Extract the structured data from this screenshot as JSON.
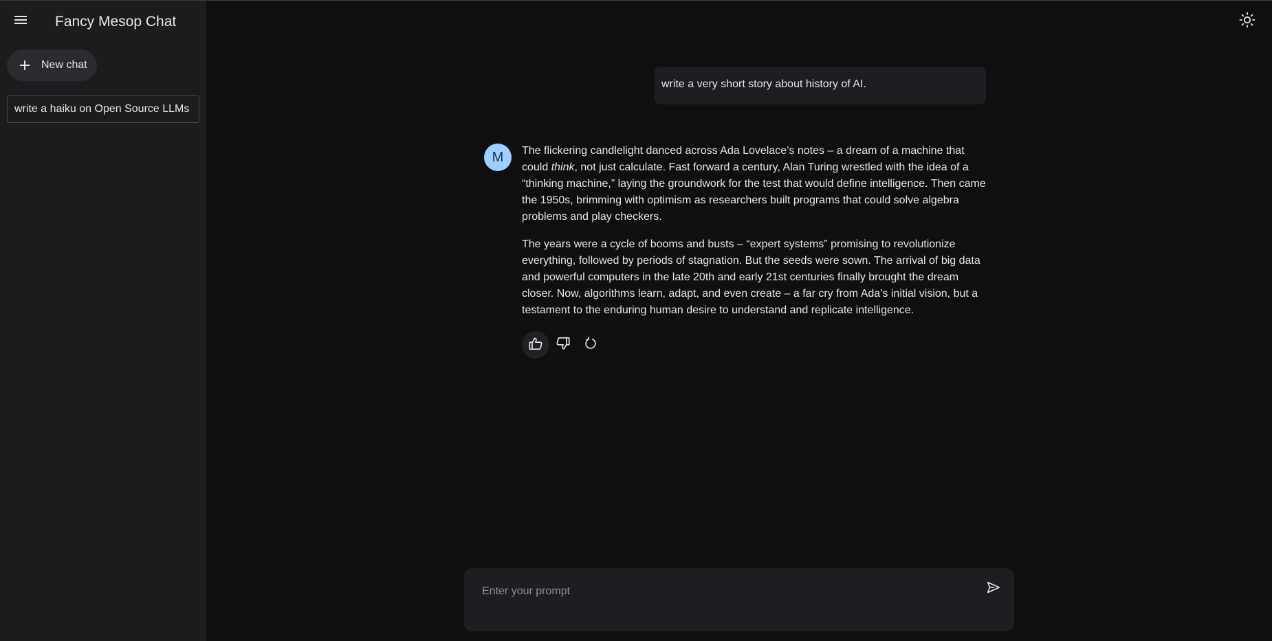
{
  "colors": {
    "sidebar_bg": "#1d1d20",
    "main_bg": "#0f0f11",
    "bubble_bg": "#1e1e22",
    "avatar_bg": "#9ecfff",
    "text": "#e6e6e9"
  },
  "sidebar": {
    "menu_icon": "hamburger-menu-icon",
    "title": "Fancy Mesop Chat",
    "new_chat": {
      "icon": "plus-icon",
      "label": "New chat"
    },
    "history": [
      {
        "label": "write a haiku on Open Source LLMs"
      }
    ]
  },
  "header": {
    "theme_icon": "sun-icon"
  },
  "conversation": {
    "user_message": "write a very short story about history of AI.",
    "assistant": {
      "avatar_letter": "M",
      "paragraph_1_before": "The flickering candlelight danced across Ada Lovelace’s notes – a dream of a machine that could ",
      "paragraph_1_emphasis": "think",
      "paragraph_1_after": ", not just calculate. Fast forward a century, Alan Turing wrestled with the idea of a “thinking machine,” laying the groundwork for the test that would define intelligence. Then came the 1950s, brimming with optimism as researchers built programs that could solve algebra problems and play checkers.",
      "paragraph_2": "The years were a cycle of booms and busts – “expert systems” promising to revolutionize everything, followed by periods of stagnation. But the seeds were sown. The arrival of big data and powerful computers in the late 20th and early 21st centuries finally brought the dream closer. Now, algorithms learn, adapt, and even create – a far cry from Ada’s initial vision, but a testament to the enduring human desire to understand and replicate intelligence."
    },
    "actions": [
      {
        "icon": "thumbs-up-icon"
      },
      {
        "icon": "thumbs-down-icon"
      },
      {
        "icon": "regenerate-icon"
      }
    ]
  },
  "prompt": {
    "placeholder": "Enter your prompt",
    "value": "",
    "send_icon": "send-icon"
  }
}
